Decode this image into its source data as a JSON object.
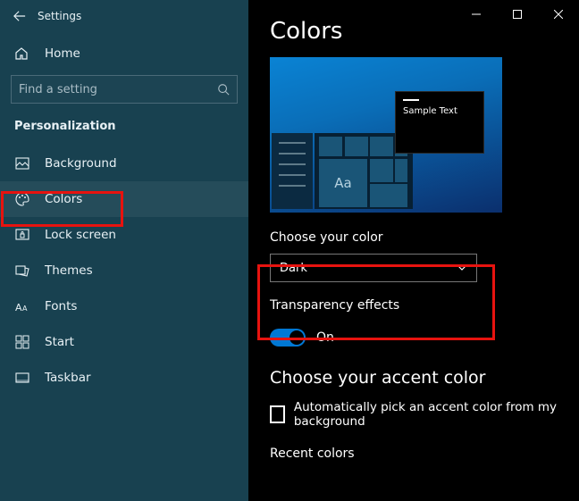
{
  "window": {
    "title": "Settings"
  },
  "sidebar": {
    "home_label": "Home",
    "search_placeholder": "Find a setting",
    "section_label": "Personalization",
    "items": [
      {
        "label": "Background"
      },
      {
        "label": "Colors"
      },
      {
        "label": "Lock screen"
      },
      {
        "label": "Themes"
      },
      {
        "label": "Fonts"
      },
      {
        "label": "Start"
      },
      {
        "label": "Taskbar"
      }
    ]
  },
  "page": {
    "title": "Colors",
    "preview": {
      "sample_text": "Sample Text",
      "aa": "Aa"
    },
    "choose_color_label": "Choose your color",
    "choose_color_value": "Dark",
    "transparency_label": "Transparency effects",
    "transparency_state": "On",
    "accent_heading": "Choose your accent color",
    "auto_accent_label": "Automatically pick an accent color from my background",
    "recent_label": "Recent colors"
  }
}
